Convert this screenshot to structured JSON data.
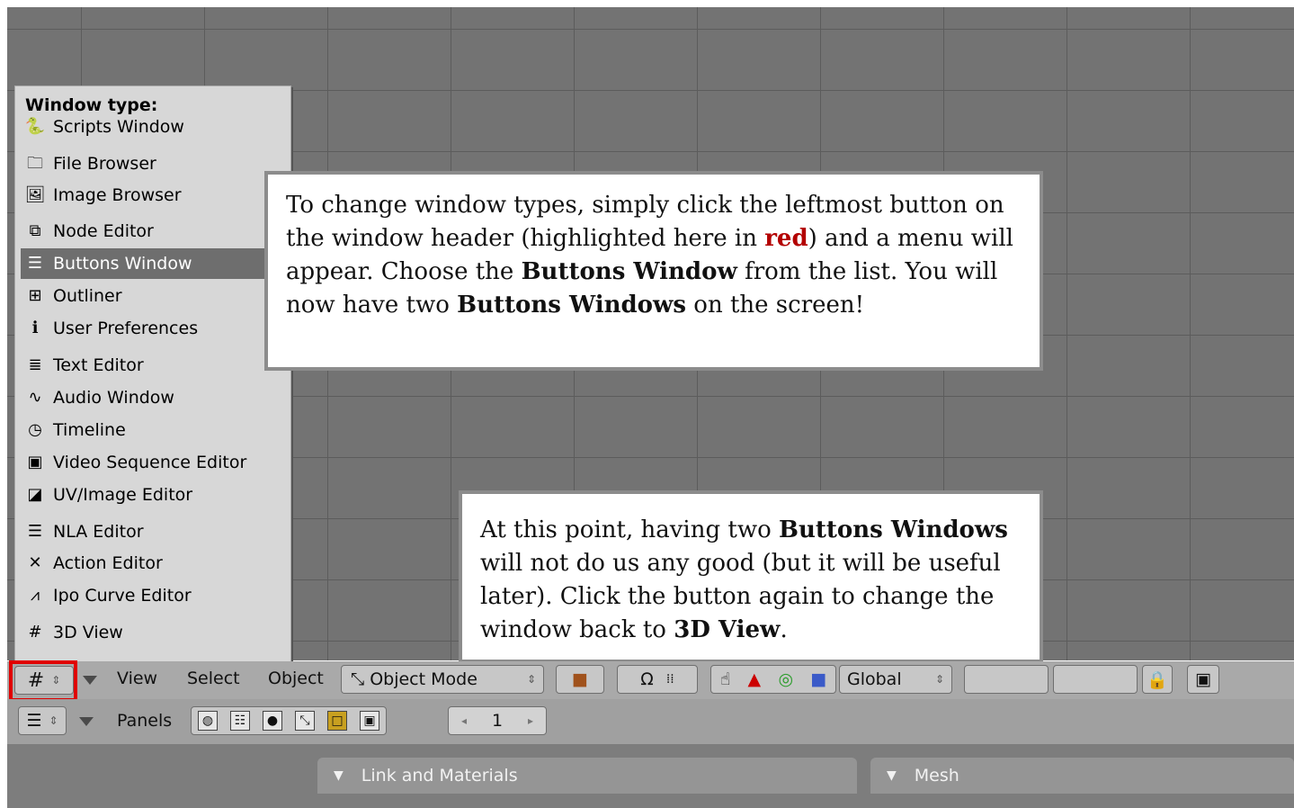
{
  "menu": {
    "title": "Window type:",
    "items": [
      {
        "label": "Scripts Window",
        "icon": "🐍"
      },
      {
        "label": "File Browser",
        "icon": "🗀"
      },
      {
        "label": "Image Browser",
        "icon": "🖼"
      },
      {
        "label": "Node Editor",
        "icon": "⧉"
      },
      {
        "label": "Buttons Window",
        "icon": "☰",
        "selected": true
      },
      {
        "label": "Outliner",
        "icon": "⊞"
      },
      {
        "label": "User Preferences",
        "icon": "ℹ"
      },
      {
        "label": "Text Editor",
        "icon": "≣"
      },
      {
        "label": "Audio Window",
        "icon": "∿"
      },
      {
        "label": "Timeline",
        "icon": "◷"
      },
      {
        "label": "Video Sequence Editor",
        "icon": "▣"
      },
      {
        "label": "UV/Image Editor",
        "icon": "◪"
      },
      {
        "label": "NLA Editor",
        "icon": "☰"
      },
      {
        "label": "Action Editor",
        "icon": "✕"
      },
      {
        "label": "Ipo Curve Editor",
        "icon": "⩘"
      },
      {
        "label": "3D View",
        "icon": "#"
      }
    ]
  },
  "callout1": {
    "p1": "To change window types, simply click the leftmost button on the window header (highlighted here in ",
    "red": "red",
    "p2": ") and a menu will appear. Choose the ",
    "b1": "Buttons Window",
    "p3": " from the list. You will now have two ",
    "b2": "Buttons Windows",
    "p4": " on the screen!"
  },
  "callout2": {
    "p1": "At this point, having two ",
    "b1": "Buttons Windows",
    "p2": " will not do us any good (but it will be useful later). Click the button again to change the window back to ",
    "b2": "3D View",
    "p3": "."
  },
  "header1": {
    "view": "View",
    "select": "Select",
    "object": "Object",
    "mode": "Object Mode",
    "orientation": "Global"
  },
  "header2": {
    "panels": "Panels",
    "frame": "1"
  },
  "panels": {
    "link_materials": "Link and Materials",
    "mesh": "Mesh"
  },
  "colors": {
    "highlight": "#e00000",
    "selected_item": "#6e6e6e"
  }
}
